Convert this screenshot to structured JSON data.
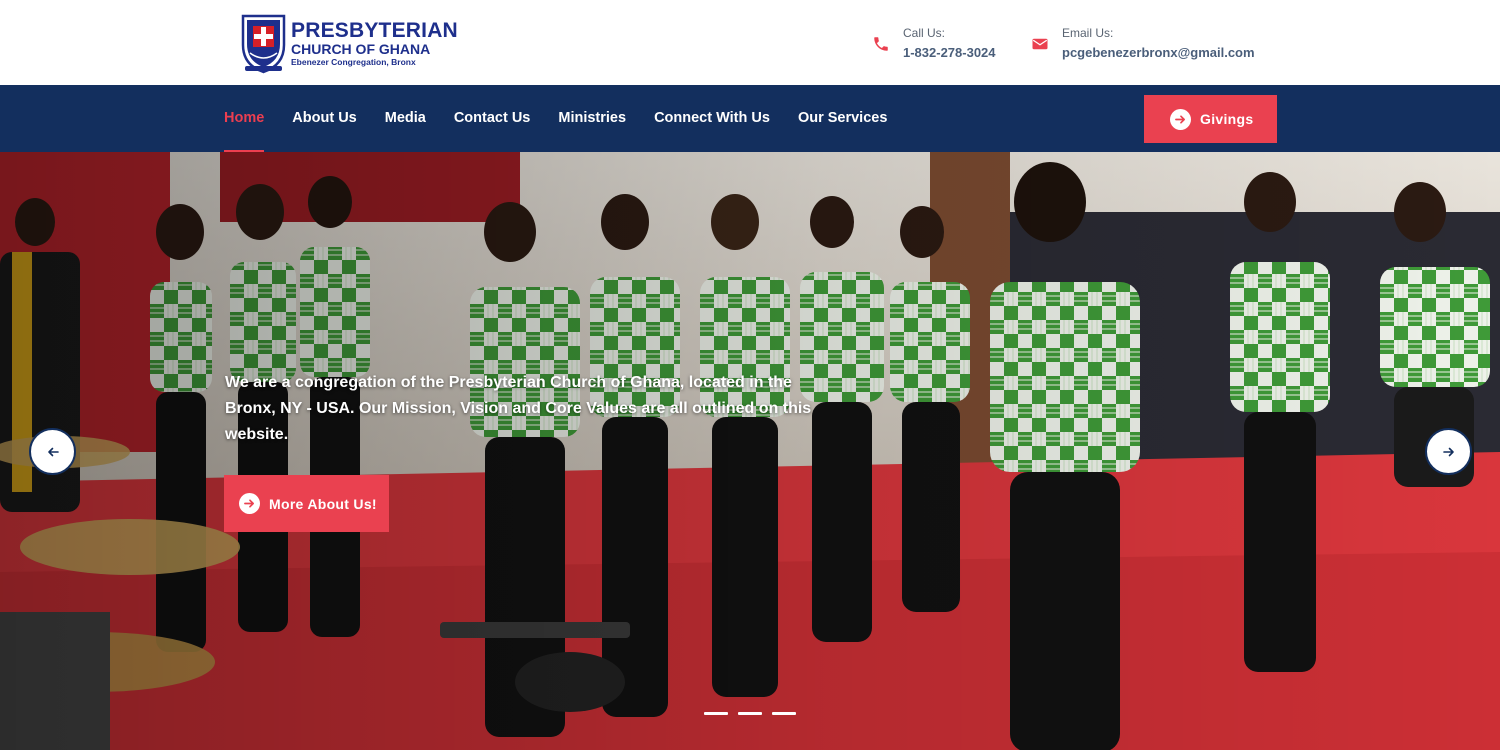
{
  "logo": {
    "line1": "PRESBYTERIAN",
    "line2": "CHURCH OF GHANA",
    "line3": "Ebenezer Congregation, Bronx"
  },
  "contact": {
    "call_label": "Call Us:",
    "call_value": "1-832-278-3024",
    "email_label": "Email Us:",
    "email_value": "pcgebenezerbronx@gmail.com"
  },
  "nav": {
    "items": [
      "Home",
      "About Us",
      "Media",
      "Contact Us",
      "Ministries",
      "Connect With Us",
      "Our Services"
    ],
    "active": "Home",
    "givings_label": "Givings"
  },
  "hero": {
    "text": "We are a congregation of the Presbyterian Church of Ghana, located in the Bronx, NY - USA. Our Mission, Vision and Core Values are all outlined on this website.",
    "button_label": "More About Us!",
    "slide_count": 3,
    "active_slide": 1
  },
  "colors": {
    "navy": "#132f5e",
    "accent_red": "#ea4150",
    "logo_blue": "#1e2f8c"
  },
  "icons": {
    "call": "phone-icon",
    "email": "envelope-icon",
    "button": "arrow-right-circle-icon",
    "prev": "arrow-left-icon",
    "next": "arrow-right-icon"
  }
}
